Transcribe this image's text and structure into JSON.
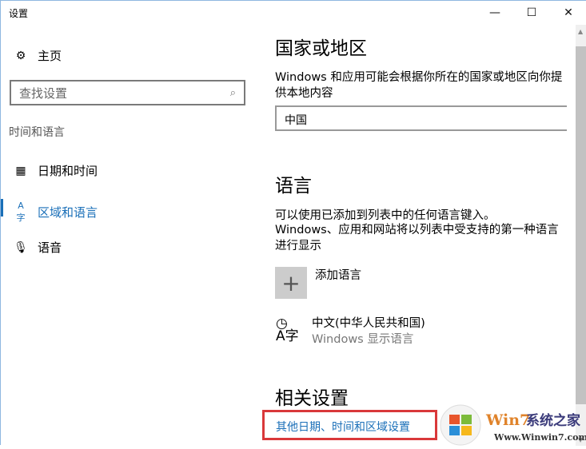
{
  "window": {
    "title": "设置",
    "minimize": "—",
    "maximize": "☐",
    "close": "✕"
  },
  "sidebar": {
    "home": "主页",
    "search_placeholder": "查找设置",
    "category": "时间和语言",
    "items": [
      {
        "label": "日期和时间"
      },
      {
        "label": "区域和语言",
        "active": true
      },
      {
        "label": "语音"
      }
    ]
  },
  "main": {
    "region": {
      "heading": "国家或地区",
      "desc": "Windows 和应用可能会根据你所在的国家或地区向你提供本地内容",
      "value": "中国"
    },
    "language": {
      "heading": "语言",
      "desc1": "可以使用已添加到列表中的任何语言键入。",
      "desc2": "Windows、应用和网站将以列表中受支持的第一种语言进行显示",
      "add": "添加语言",
      "lang_name": "中文(中华人民共和国)",
      "lang_sub": "Windows 显示语言"
    },
    "related": {
      "heading": "相关设置",
      "link": "其他日期、时间和区域设置"
    }
  },
  "watermark": {
    "brand": "Win7系统之家",
    "url": "Www.Winwin7.com"
  },
  "colors": {
    "accent": "#1a6fb8",
    "highlight_box": "#d9383a"
  }
}
